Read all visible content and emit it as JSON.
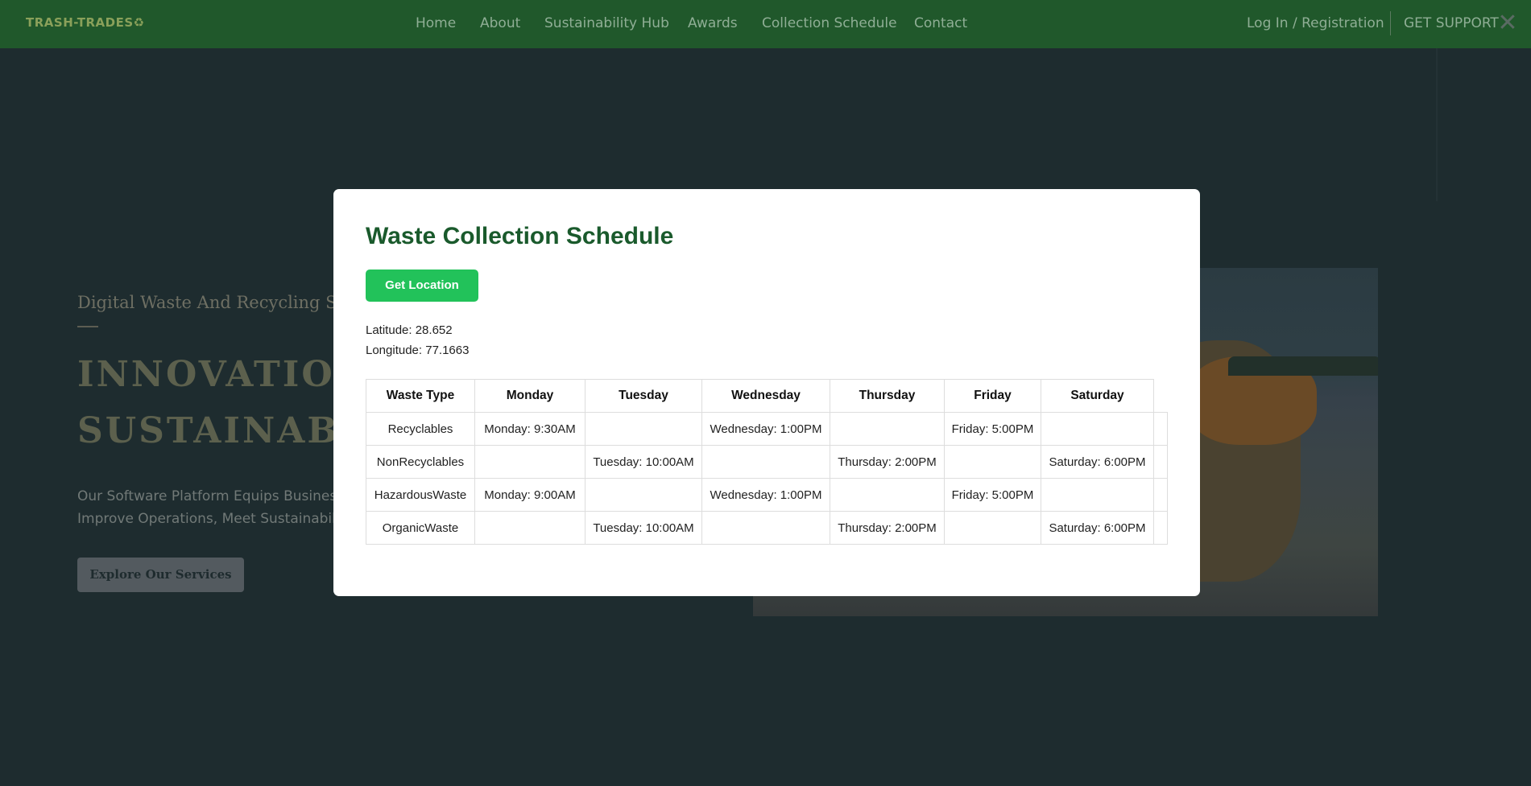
{
  "header": {
    "logo": "TRASH-TRADES♻",
    "nav": [
      "Home",
      "About",
      "Sustainability Hub",
      "Awards",
      "Collection Schedule",
      "Contact"
    ],
    "login": "Log In / Registration",
    "support": "GET SUPPORT",
    "close_icon": "✕"
  },
  "hero": {
    "subtitle": "Digital Waste And Recycling Sol",
    "title_line1": "INNOVATION",
    "title_line2": "SUSTAINABIL",
    "desc_line1": "Our Software Platform Equips Businesse",
    "desc_line2": "Improve Operations, Meet Sustainability",
    "button": "Explore Our Services"
  },
  "modal": {
    "title": "Waste Collection Schedule",
    "location_button": "Get Location",
    "latitude": "Latitude: 28.652",
    "longitude": "Longitude: 77.1663",
    "columns": [
      "Waste Type",
      "Monday",
      "Tuesday",
      "Wednesday",
      "Thursday",
      "Friday",
      "Saturday"
    ],
    "rows": [
      [
        "Recyclables",
        "Monday: 9:30AM",
        "",
        "Wednesday: 1:00PM",
        "",
        "Friday: 5:00PM",
        ""
      ],
      [
        "NonRecyclables",
        "",
        "Tuesday: 10:00AM",
        "",
        "Thursday: 2:00PM",
        "",
        "Saturday: 6:00PM"
      ],
      [
        "HazardousWaste",
        "Monday: 9:00AM",
        "",
        "Wednesday: 1:00PM",
        "",
        "Friday: 5:00PM",
        ""
      ],
      [
        "OrganicWaste",
        "",
        "Tuesday: 10:00AM",
        "",
        "Thursday: 2:00PM",
        "",
        "Saturday: 6:00PM"
      ]
    ]
  },
  "colors": {
    "header_bg": "#20582b",
    "page_bg": "#1e2c2f",
    "title_green": "#1a5a2c",
    "button_green": "#22c25a"
  }
}
